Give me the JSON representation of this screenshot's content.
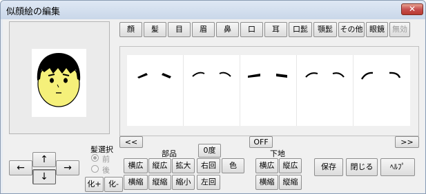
{
  "window": {
    "title": "似顔絵の編集",
    "close_label": "✕"
  },
  "category_tabs": [
    "顔",
    "髪",
    "目",
    "眉",
    "鼻",
    "口",
    "耳",
    "口髭",
    "顎髭",
    "その他",
    "眼鏡",
    "無効"
  ],
  "nav": {
    "scroll_left": "<<",
    "scroll_right": ">>",
    "off_label": "OFF"
  },
  "arrows": {
    "up": "↑",
    "down": "↓",
    "left": "←",
    "right": "→"
  },
  "hair_select": {
    "label": "髪選択",
    "front": "前",
    "back": "後",
    "front_checked": true
  },
  "chemistry": {
    "plus": "化+",
    "minus": "化-"
  },
  "parts": {
    "label": "部品",
    "widen": "横広",
    "heighten": "縦広",
    "enlarge": "拡大",
    "narrow": "横縮",
    "shorten": "縦縮",
    "shrink": "縮小",
    "angle": "0度",
    "rotate_right": "右回",
    "rotate_left": "左回",
    "color": "色"
  },
  "base": {
    "label": "下地",
    "widen": "横広",
    "heighten": "縦広",
    "narrow": "横縮",
    "shorten": "縦縮"
  },
  "actions": {
    "save": "保存",
    "close": "閉じる",
    "help": "ﾍﾙﾌﾟ"
  },
  "colors": {
    "face": "#f5f07a",
    "hair": "#000000",
    "window_border": "#8a9bb2"
  }
}
